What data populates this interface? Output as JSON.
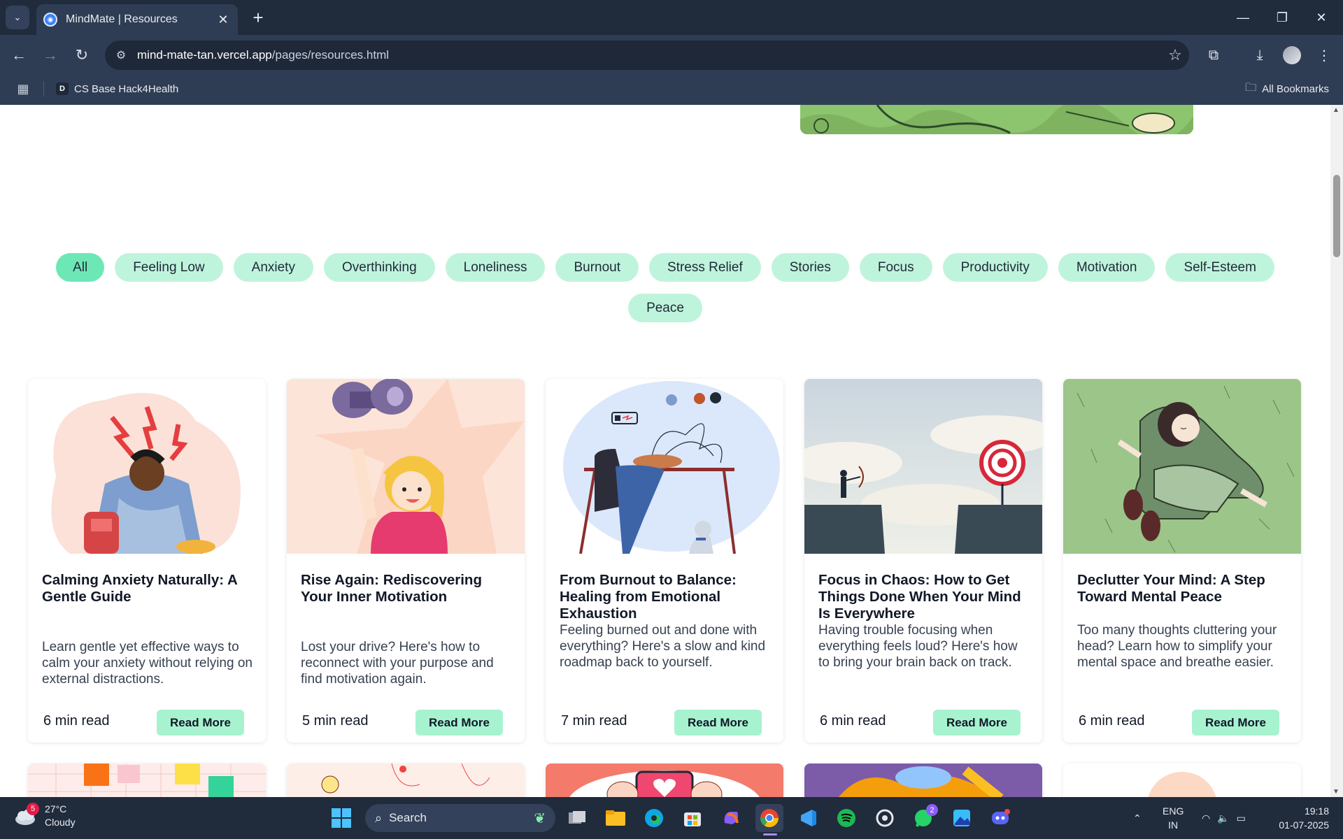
{
  "browser": {
    "tab_title": "MindMate | Resources",
    "url_domain": "mind-mate-tan.vercel.app",
    "url_path": "/pages/resources.html",
    "bookmark": "CS Base Hack4Health",
    "bookmark_letter": "D",
    "all_bookmarks": "All Bookmarks"
  },
  "filters": [
    "All",
    "Feeling Low",
    "Anxiety",
    "Overthinking",
    "Loneliness",
    "Burnout",
    "Stress Relief",
    "Stories",
    "Focus",
    "Productivity",
    "Motivation",
    "Self-Esteem",
    "Peace"
  ],
  "active_filter": "All",
  "cards": [
    {
      "title": "Calming Anxiety Naturally: A Gentle Guide",
      "desc": "Learn gentle yet effective ways to calm your anxiety without relying on external distractions.",
      "read": "6 min read",
      "button": "Read More"
    },
    {
      "title": "Rise Again: Rediscovering Your Inner Motivation",
      "desc": "Lost your drive? Here's how to reconnect with your purpose and find motivation again.",
      "read": "5 min read",
      "button": "Read More"
    },
    {
      "title": "From Burnout to Balance: Healing from Emotional Exhaustion",
      "desc": "Feeling burned out and done with everything? Here's a slow and kind roadmap back to yourself.",
      "read": "7 min read",
      "button": "Read More"
    },
    {
      "title": "Focus in Chaos: How to Get Things Done When Your Mind Is Everywhere",
      "desc": "Having trouble focusing when everything feels loud? Here's how to bring your brain back on track.",
      "read": "6 min read",
      "button": "Read More"
    },
    {
      "title": "Declutter Your Mind: A Step Toward Mental Peace",
      "desc": "Too many thoughts cluttering your head? Learn how to simplify your mental space and breathe easier.",
      "read": "6 min read",
      "button": "Read More"
    }
  ],
  "taskbar": {
    "weather_temp": "27°C",
    "weather_desc": "Cloudy",
    "weather_badge": "5",
    "search": "Search",
    "whatsapp_badge": "2",
    "lang1": "ENG",
    "lang2": "IN",
    "time": "19:18",
    "date": "01-07-2025"
  }
}
